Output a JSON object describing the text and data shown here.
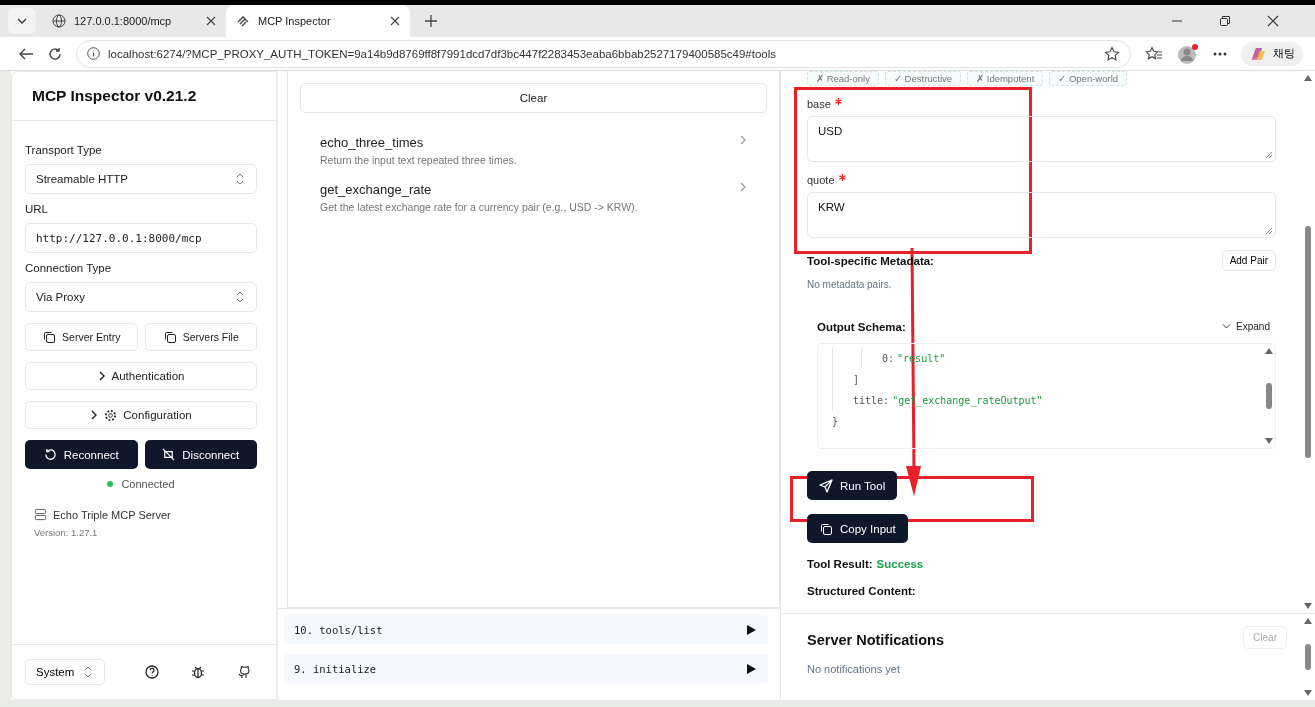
{
  "browser": {
    "tabs": [
      {
        "title": "127.0.0.1:8000/mcp",
        "selected": false
      },
      {
        "title": "MCP Inspector",
        "selected": true
      }
    ],
    "address": "localhost:6274/?MCP_PROXY_AUTH_TOKEN=9a14b9d8769ff8f7991dcd7df3bc447f2283453eaba6bbab2527179400585c49#tools",
    "copilot_label": "채팅"
  },
  "sidebar": {
    "title": "MCP Inspector v0.21.2",
    "transport_type": {
      "label": "Transport Type",
      "value": "Streamable HTTP"
    },
    "url": {
      "label": "URL",
      "value": "http://127.0.0.1:8000/mcp"
    },
    "connection_type": {
      "label": "Connection Type",
      "value": "Via Proxy"
    },
    "server_entry": "Server Entry",
    "servers_file": "Servers File",
    "authentication": "Authentication",
    "configuration": "Configuration",
    "reconnect": "Reconnect",
    "disconnect": "Disconnect",
    "status": {
      "text": "Connected",
      "connected": true
    },
    "server": {
      "name": "Echo Triple MCP Server",
      "version": "Version: 1.27.1"
    },
    "theme": "System"
  },
  "tools": {
    "clear": "Clear",
    "items": [
      {
        "name": "echo_three_times",
        "description": "Return the input text repeated three times."
      },
      {
        "name": "get_exchange_rate",
        "description": "Get the latest exchange rate for a currency pair (e.g., USD -> KRW)."
      }
    ]
  },
  "history": [
    {
      "label": "10. tools/list"
    },
    {
      "label": "9. initialize"
    }
  ],
  "detail": {
    "hints": [
      {
        "mark": "✗",
        "label": "Read-only"
      },
      {
        "mark": "✓",
        "label": "Destructive"
      },
      {
        "mark": "✗",
        "label": "Idempotent"
      },
      {
        "mark": "✓",
        "label": "Open-world"
      }
    ],
    "fields": [
      {
        "label": "base",
        "required": true,
        "value": "USD"
      },
      {
        "label": "quote",
        "required": true,
        "value": "KRW"
      }
    ],
    "metadata": {
      "title": "Tool-specific Metadata:",
      "add": "Add Pair",
      "empty": "No metadata pairs."
    },
    "output_schema": {
      "title": "Output Schema:",
      "expand": "Expand",
      "tree": {
        "children": [
          {
            "children": [
              {
                "key": "0:",
                "value": "\"result\""
              }
            ],
            "close": "]"
          },
          {
            "key": "title:",
            "value": "\"get_exchange_rateOutput\""
          }
        ],
        "close": "}"
      }
    },
    "run": "Run Tool",
    "copy": "Copy Input",
    "result": {
      "label": "Tool Result:",
      "status": "Success"
    },
    "structured": "Structured Content:"
  },
  "notifications": {
    "title": "Server Notifications",
    "clear": "Clear",
    "empty": "No notifications yet"
  }
}
